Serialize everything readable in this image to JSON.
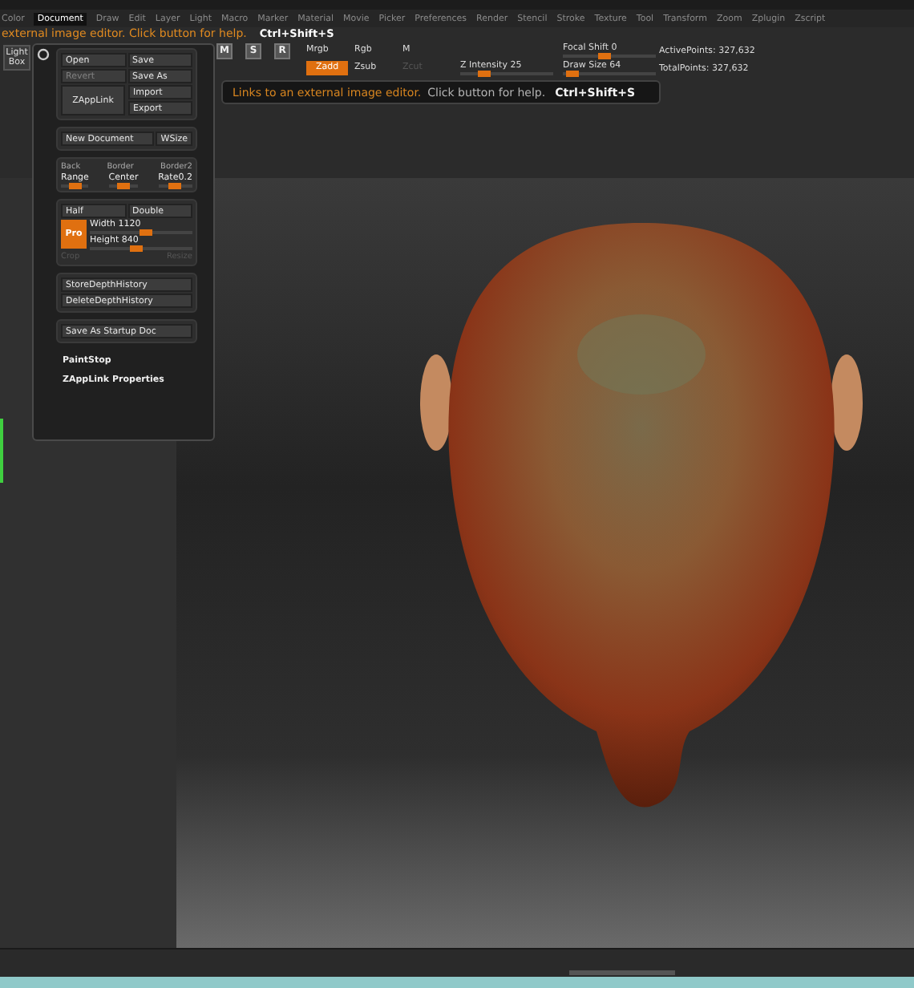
{
  "menu": [
    {
      "label": "Color",
      "selected": false
    },
    {
      "label": "Document",
      "selected": true
    },
    {
      "label": "Draw",
      "selected": false
    },
    {
      "label": "Edit",
      "selected": false
    },
    {
      "label": "Layer",
      "selected": false
    },
    {
      "label": "Light",
      "selected": false
    },
    {
      "label": "Macro",
      "selected": false
    },
    {
      "label": "Marker",
      "selected": false
    },
    {
      "label": "Material",
      "selected": false
    },
    {
      "label": "Movie",
      "selected": false
    },
    {
      "label": "Picker",
      "selected": false
    },
    {
      "label": "Preferences",
      "selected": false
    },
    {
      "label": "Render",
      "selected": false
    },
    {
      "label": "Stencil",
      "selected": false
    },
    {
      "label": "Stroke",
      "selected": false
    },
    {
      "label": "Texture",
      "selected": false
    },
    {
      "label": "Tool",
      "selected": false
    },
    {
      "label": "Transform",
      "selected": false
    },
    {
      "label": "Zoom",
      "selected": false
    },
    {
      "label": "Zplugin",
      "selected": false
    },
    {
      "label": "Zscript",
      "selected": false
    }
  ],
  "hint": {
    "text": "external image editor. Click button for help.",
    "shortcut": "Ctrl+Shift+S"
  },
  "toolbar": {
    "light_box": "Light Box",
    "transform_buttons": [
      "M",
      "S",
      "R"
    ],
    "color_modes": [
      "Mrgb",
      "Rgb",
      "M"
    ],
    "z_modes": [
      {
        "label": "Zadd",
        "selected": true,
        "disabled": false
      },
      {
        "label": "Zsub",
        "selected": false,
        "disabled": false
      },
      {
        "label": "Zcut",
        "selected": false,
        "disabled": true
      }
    ],
    "sliders": [
      {
        "label": "Focal Shift",
        "value": "0",
        "level": 0.45
      },
      {
        "label": "Z Intensity",
        "value": "25",
        "level": 0.25
      },
      {
        "label": "Draw Size",
        "value": "64",
        "level": 0.1
      }
    ],
    "stats": [
      "ActivePoints: 327,632",
      "TotalPoints: 327,632"
    ]
  },
  "tooltip": {
    "text": "Links to an external image editor.",
    "help": "Click button for help.",
    "shortcut": "Ctrl+Shift+S"
  },
  "document_menu": {
    "file_buttons": [
      {
        "label": "Open",
        "disabled": false
      },
      {
        "label": "Save",
        "disabled": false
      },
      {
        "label": "Revert",
        "disabled": true
      },
      {
        "label": "Save As",
        "disabled": false
      }
    ],
    "zapplink": "ZAppLink",
    "import_export": [
      "Import",
      "Export"
    ],
    "new_document": "New Document",
    "wsize": "WSize",
    "border_options": [
      "Back",
      "Border",
      "Border2"
    ],
    "border_sliders": [
      {
        "label": "Range",
        "level": 0.5
      },
      {
        "label": "Center",
        "level": 0.5
      },
      {
        "label": "Rate",
        "value": "0.2",
        "level": 0.5
      }
    ],
    "size_buttons": [
      "Half",
      "Double"
    ],
    "pro": {
      "label": "Pro",
      "on": true
    },
    "size_sliders": [
      {
        "label": "Width",
        "value": "1120",
        "level": 0.55
      },
      {
        "label": "Height",
        "value": "840",
        "level": 0.45
      }
    ],
    "crop_resize": [
      {
        "label": "Crop",
        "disabled": true
      },
      {
        "label": "Resize",
        "disabled": true
      }
    ],
    "depth_history": [
      "StoreDepthHistory",
      "DeleteDepthHistory"
    ],
    "startup": "Save As Startup Doc",
    "links": [
      "PaintStop",
      "ZAppLink Properties"
    ]
  }
}
